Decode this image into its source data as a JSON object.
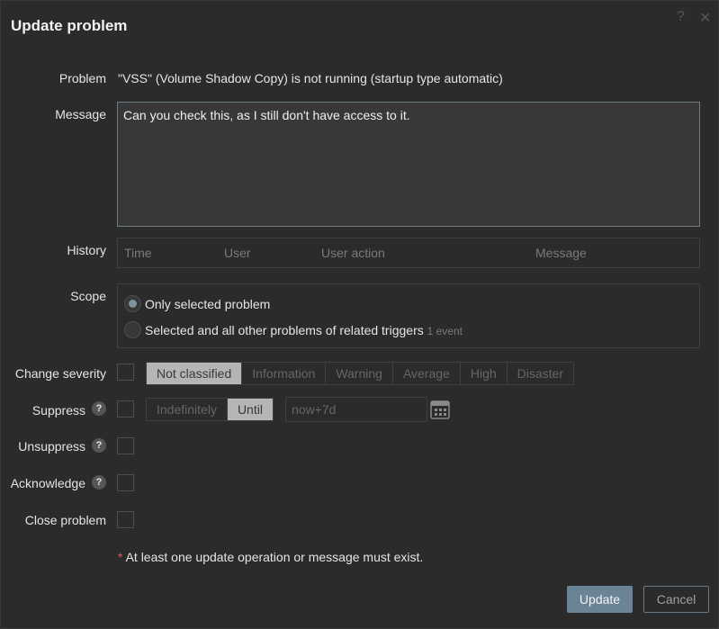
{
  "dialog": {
    "title": "Update problem",
    "help_glyph": "?",
    "close_glyph": "✕"
  },
  "problem": {
    "label": "Problem",
    "value": "\"VSS\" (Volume Shadow Copy) is not running (startup type automatic)"
  },
  "message": {
    "label": "Message",
    "value": "Can you check this, as I still don't have access to it."
  },
  "history": {
    "label": "History",
    "columns": [
      "Time",
      "User",
      "User action",
      "Message"
    ]
  },
  "scope": {
    "label": "Scope",
    "options": [
      {
        "label": "Only selected problem",
        "checked": true
      },
      {
        "label": "Selected and all other problems of related triggers",
        "note": "1 event",
        "checked": false
      }
    ]
  },
  "severity": {
    "label": "Change severity",
    "options": [
      "Not classified",
      "Information",
      "Warning",
      "Average",
      "High",
      "Disaster"
    ],
    "selected": "Not classified"
  },
  "suppress": {
    "label": "Suppress",
    "help": "?",
    "options": [
      "Indefinitely",
      "Until"
    ],
    "selected": "Until",
    "until_placeholder": "now+7d"
  },
  "unsuppress": {
    "label": "Unsuppress",
    "help": "?"
  },
  "acknowledge": {
    "label": "Acknowledge",
    "help": "?"
  },
  "close_problem": {
    "label": "Close problem"
  },
  "note": {
    "asterisk": "*",
    "text": "At least one update operation or message must exist."
  },
  "buttons": {
    "update": "Update",
    "cancel": "Cancel"
  },
  "colors": {
    "background": "#2b2b2b",
    "primary_button": "#6a8395",
    "selected_segment": "#b5b5b5",
    "required_asterisk": "#e45959"
  }
}
